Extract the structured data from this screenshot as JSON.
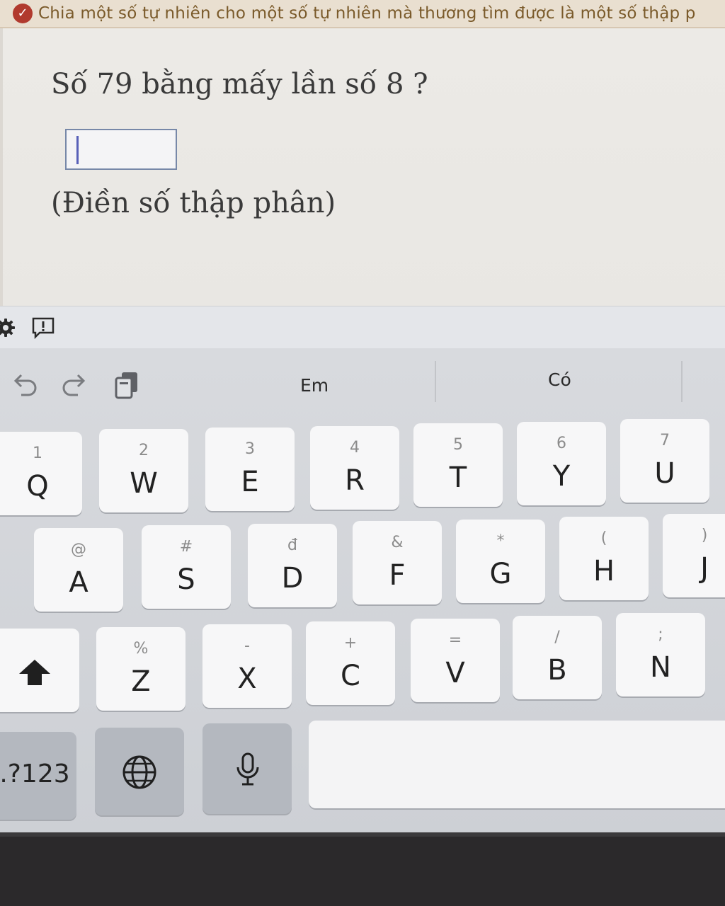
{
  "banner": {
    "text": "Chia một số tự nhiên cho một số tự nhiên mà thương tìm được là một số thập p",
    "icon": "check-circle-icon",
    "accent": "#b13a2e"
  },
  "question": {
    "prompt": "Số 79 bằng mấy lần số 8 ?",
    "answer_value": "",
    "hint": "(Điền số thập phân)"
  },
  "page_tools": {
    "icons": [
      "gear-icon",
      "report-icon"
    ]
  },
  "keyboard": {
    "toolbar_icons": [
      "undo-icon",
      "redo-icon",
      "clipboard-icon"
    ],
    "suggestions": [
      "Em",
      "Có"
    ],
    "row1": [
      {
        "alt": "1",
        "key": "Q"
      },
      {
        "alt": "2",
        "key": "W"
      },
      {
        "alt": "3",
        "key": "E"
      },
      {
        "alt": "4",
        "key": "R"
      },
      {
        "alt": "5",
        "key": "T"
      },
      {
        "alt": "6",
        "key": "Y"
      },
      {
        "alt": "7",
        "key": "U"
      }
    ],
    "row2": [
      {
        "alt": "@",
        "key": "A"
      },
      {
        "alt": "#",
        "key": "S"
      },
      {
        "alt": "đ",
        "key": "D"
      },
      {
        "alt": "&",
        "key": "F"
      },
      {
        "alt": "*",
        "key": "G"
      },
      {
        "alt": "(",
        "key": "H"
      },
      {
        "alt": ")",
        "key": "J"
      }
    ],
    "row3": [
      {
        "alt": "%",
        "key": "Z"
      },
      {
        "alt": "-",
        "key": "X"
      },
      {
        "alt": "+",
        "key": "C"
      },
      {
        "alt": "=",
        "key": "V"
      },
      {
        "alt": "/",
        "key": "B"
      },
      {
        "alt": ";",
        "key": "N"
      }
    ],
    "row4": {
      "symbols_label": ".?123",
      "globe_icon": "globe-icon",
      "mic_icon": "microphone-icon",
      "shift_icon": "shift-icon"
    }
  }
}
